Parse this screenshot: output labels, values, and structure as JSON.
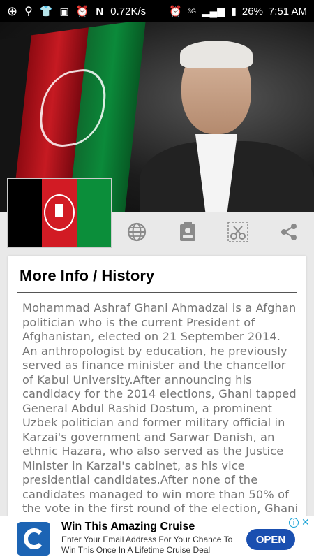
{
  "statusbar": {
    "speed": "0.72K/s",
    "network": "3G",
    "battery": "26%",
    "time": "7:51 AM",
    "left_icons": [
      "plus-icon",
      "location-icon",
      "tshirt-icon",
      "image-icon",
      "alarm-icon",
      "n-icon"
    ],
    "right_icons": [
      "alarm-icon",
      "signal-icon",
      "battery-icon"
    ]
  },
  "hero": {
    "flag_colors": [
      "#000000",
      "#d21b24",
      "#0b8e3a"
    ]
  },
  "toolbar": {
    "icons": [
      "globe-icon",
      "contact-card-icon",
      "scissors-icon",
      "share-icon"
    ]
  },
  "card": {
    "title": "More Info / History",
    "body": "Mohammad Ashraf Ghani Ahmadzai is a Afghan politician who is the current President of Afghanistan, elected on 21 September 2014. An anthropologist by education, he previously served as finance minister and the chancellor of Kabul University.After announcing his candidacy for the 2014 elections, Ghani tapped General Abdul Rashid Dostum, a prominent Uzbek politician and former military official in Karzai's government and Sarwar Danish, an ethnic Hazara, who also served as the Justice Minister in Karzai's cabinet, as his vice presidential candidates.After none of the candidates managed to win more than 50% of the vote in the first round of the election, Ghani and Abdullah Abdullah, the two front runners from the first round, contested in a runoff election"
  },
  "ad": {
    "title": "Win This Amazing Cruise",
    "description": "Enter Your Email Address For Your Chance To Win This Once In A Lifetime Cruise Deal",
    "button": "OPEN",
    "info": "i",
    "close": "✕",
    "accent": "#1a4fb0"
  }
}
